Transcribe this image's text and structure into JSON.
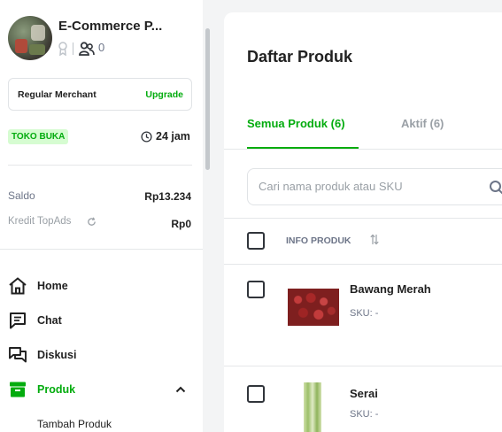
{
  "sidebar": {
    "shop_name": "E-Commerce P...",
    "follower_count": "0",
    "merchant": {
      "label": "Regular Merchant",
      "upgrade": "Upgrade"
    },
    "status": {
      "badge": "TOKO BUKA",
      "hours": "24 jam"
    },
    "balance": {
      "saldo_label": "Saldo",
      "saldo_value": "Rp13.234",
      "kredit_label": "Kredit TopAds",
      "kredit_value": "Rp0"
    },
    "nav": [
      {
        "label": "Home",
        "icon": "home-icon"
      },
      {
        "label": "Chat",
        "icon": "chat-icon"
      },
      {
        "label": "Diskusi",
        "icon": "discussion-icon"
      },
      {
        "label": "Produk",
        "icon": "product-icon",
        "active": true,
        "expanded": true
      }
    ],
    "sub_item": "Tambah Produk"
  },
  "main": {
    "title": "Daftar Produk",
    "tabs": [
      {
        "label": "Semua Produk (6)",
        "active": true
      },
      {
        "label": "Aktif (6)",
        "active": false
      }
    ],
    "search": {
      "placeholder": "Cari nama produk atau SKU"
    },
    "table": {
      "header": "INFO PRODUK",
      "rows": [
        {
          "name": "Bawang Merah",
          "sku": "SKU: -"
        },
        {
          "name": "Serai",
          "sku": "SKU: -"
        }
      ]
    }
  },
  "colors": {
    "accent": "#03ac0e",
    "badge_bg": "#d6fcd1",
    "page_bg": "#f3f4f5"
  }
}
